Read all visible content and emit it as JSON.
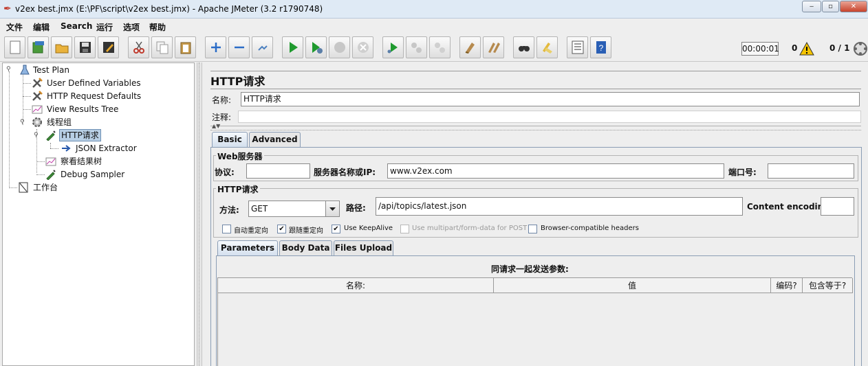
{
  "window": {
    "title": "v2ex best.jmx (E:\\PF\\script\\v2ex best.jmx) - Apache JMeter (3.2 r1790748)"
  },
  "menu": [
    "文件",
    "编辑",
    "Search",
    "运行",
    "选项",
    "帮助"
  ],
  "toolbar": {
    "buttons": [
      "new-icon",
      "templates-icon",
      "open-icon",
      "save-icon",
      "save-as-icon",
      "cut-icon",
      "copy-icon",
      "paste-icon",
      "expand-icon",
      "collapse-icon",
      "toggle-icon",
      "start-icon",
      "start-no-pause-icon",
      "stop-icon",
      "shutdown-icon",
      "remote-start-icon",
      "remote-stop-icon",
      "remote-shutdown-icon",
      "clear-icon",
      "clear-all-icon",
      "search-icon",
      "reset-search-icon",
      "function-helper-icon",
      "help-icon"
    ],
    "timer": "00:00:01",
    "errors": "0",
    "threads": "0 / 1"
  },
  "tree": {
    "test_plan": "Test Plan",
    "udv": "User Defined Variables",
    "defaults": "HTTP Request Defaults",
    "results_tree": "View Results Tree",
    "thread_group": "线程组",
    "http_request": "HTTP请求",
    "json_extractor": "JSON Extractor",
    "view_results": "察看结果树",
    "debug_sampler": "Debug Sampler",
    "workbench": "工作台"
  },
  "panel": {
    "title": "HTTP请求",
    "name_label": "名称:",
    "name_value": "HTTP请求",
    "comment_label": "注释:",
    "tabs": [
      "Basic",
      "Advanced"
    ],
    "web_server_title": "Web服务器",
    "protocol_label": "协议:",
    "server_label": "服务器名称或IP:",
    "server_value": "www.v2ex.com",
    "port_label": "端口号:",
    "http_request_title": "HTTP请求",
    "method_label": "方法:",
    "method_value": "GET",
    "path_label": "路径:",
    "path_value": "/api/topics/latest.json",
    "encoding_label": "Content encoding:",
    "checkboxes": [
      {
        "label": "自动重定向",
        "checked": false
      },
      {
        "label": "跟随重定向",
        "checked": true
      },
      {
        "label": "Use KeepAlive",
        "checked": true
      },
      {
        "label": "Use multipart/form-data for POST",
        "checked": false
      },
      {
        "label": "Browser-compatible headers",
        "checked": false
      }
    ],
    "sub_tabs": [
      "Parameters",
      "Body Data",
      "Files Upload"
    ],
    "params_caption": "同请求一起发送参数:",
    "columns": [
      "名称:",
      "值",
      "编码?",
      "包含等于?"
    ]
  }
}
